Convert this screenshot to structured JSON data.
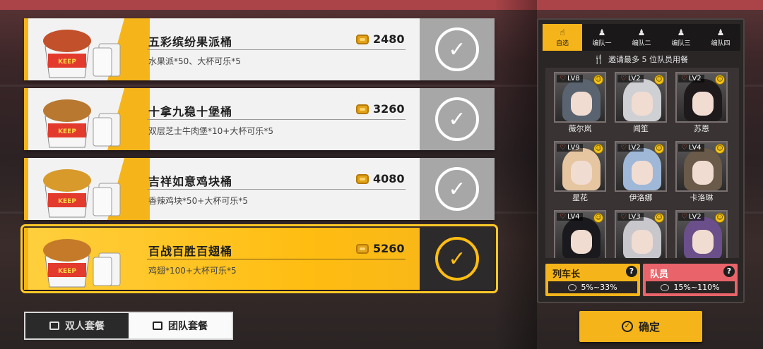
{
  "meals": [
    {
      "name": "五彩缤纷果派桶",
      "desc": "水果派*50、大杯可乐*5",
      "price": "2480",
      "selected": false,
      "food_color": "#c2502a"
    },
    {
      "name": "十拿九稳十堡桶",
      "desc": "双层芝士牛肉堡*10+大杯可乐*5",
      "price": "3260",
      "selected": false,
      "food_color": "#b87830"
    },
    {
      "name": "吉祥如意鸡块桶",
      "desc": "香辣鸡块*50+大杯可乐*5",
      "price": "4080",
      "selected": false,
      "food_color": "#d89a2a"
    },
    {
      "name": "百战百胜百翅桶",
      "desc": "鸡翅*100+大杯可乐*5",
      "price": "5260",
      "selected": true,
      "food_color": "#c47a28"
    }
  ],
  "set_tabs": {
    "duo": "双人套餐",
    "team": "团队套餐",
    "active": "team"
  },
  "team_tabs": [
    {
      "label": "自选",
      "glyph": "☝",
      "active": true
    },
    {
      "label": "编队一",
      "glyph": "♟",
      "active": false
    },
    {
      "label": "编队二",
      "glyph": "♟",
      "active": false
    },
    {
      "label": "编队三",
      "glyph": "♟",
      "active": false
    },
    {
      "label": "编队四",
      "glyph": "♟",
      "active": false
    }
  ],
  "invite_text": "邀请最多 5 位队员用餐",
  "characters": [
    {
      "name": "薇尔岚",
      "level": "LV8",
      "hair": "#5a6470"
    },
    {
      "name": "闻笙",
      "level": "LV2",
      "hair": "#cfd0d4"
    },
    {
      "name": "苏恩",
      "level": "LV2",
      "hair": "#1e1a1c"
    },
    {
      "name": "星花",
      "level": "LV9",
      "hair": "#e6c6a0"
    },
    {
      "name": "伊洛娜",
      "level": "LV2",
      "hair": "#9fb8d8"
    },
    {
      "name": "卡洛琳",
      "level": "LV4",
      "hair": "#6a5a4a"
    },
    {
      "name": "",
      "level": "LV4",
      "hair": "#1a1a1e"
    },
    {
      "name": "",
      "level": "LV3",
      "hair": "#c8c8cc"
    },
    {
      "name": "",
      "level": "LV2",
      "hair": "#6a4f8a"
    }
  ],
  "roles": {
    "captain": {
      "title": "列车长",
      "range": "5%~33%",
      "help": "?"
    },
    "member": {
      "title": "队员",
      "range": "15%~110%",
      "help": "?"
    }
  },
  "confirm_label": "确定",
  "colors": {
    "accent": "#f5b51a",
    "member_red": "#e9646a",
    "panel_dark": "#2a2626"
  }
}
